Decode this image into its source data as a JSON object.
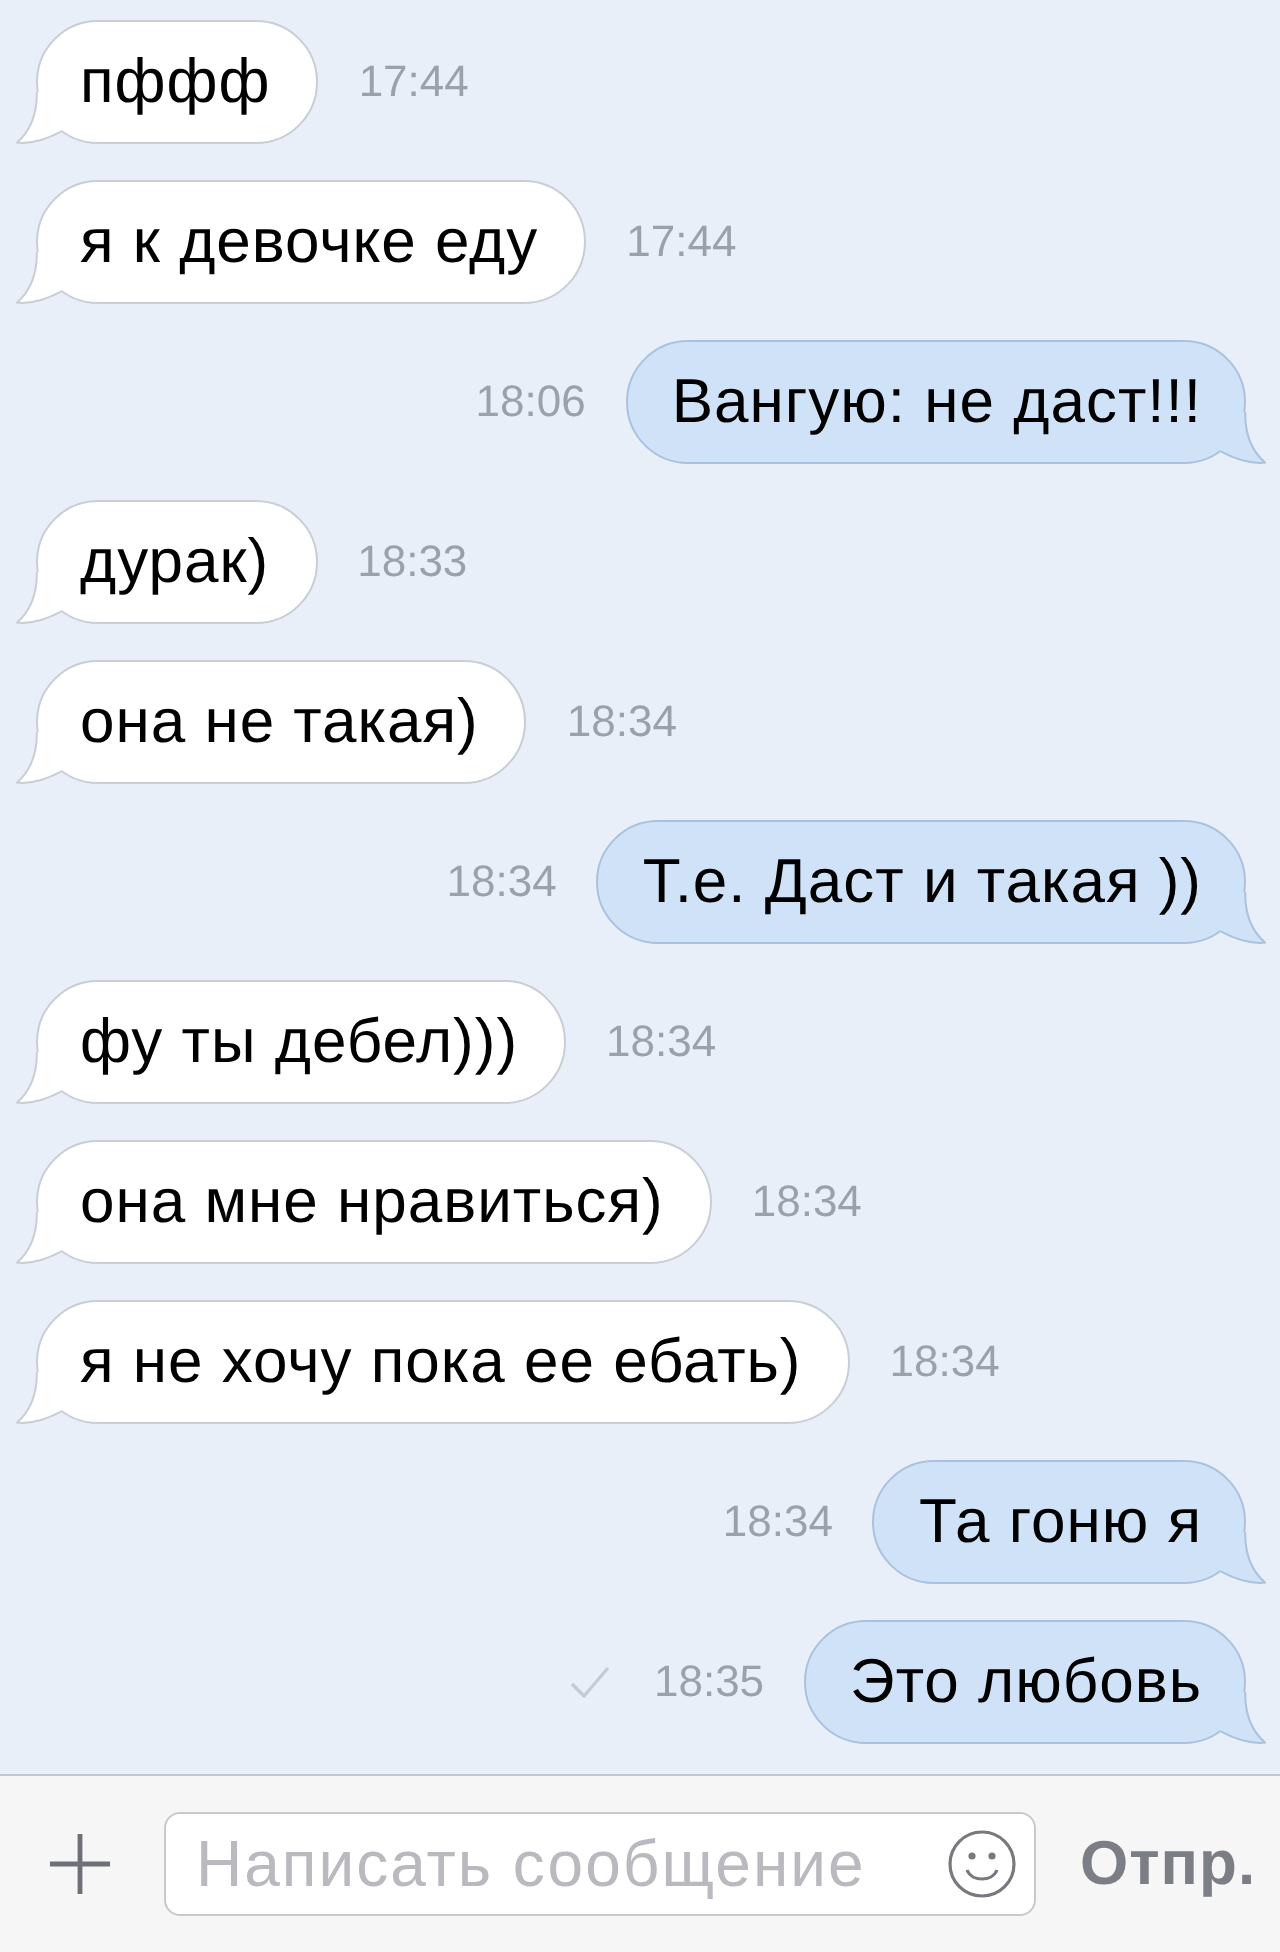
{
  "messages": [
    {
      "kind": "incoming",
      "text": "пффф",
      "time": "17:44",
      "ticked": false
    },
    {
      "kind": "incoming",
      "text": "я к девочке еду",
      "time": "17:44",
      "ticked": false
    },
    {
      "kind": "outgoing",
      "text": "Вангую: не даст!!!",
      "time": "18:06",
      "ticked": false
    },
    {
      "kind": "incoming",
      "text": "дурак)",
      "time": "18:33",
      "ticked": false
    },
    {
      "kind": "incoming",
      "text": "она не такая)",
      "time": "18:34",
      "ticked": false
    },
    {
      "kind": "outgoing",
      "text": "Т.е. Даст и такая ))",
      "time": "18:34",
      "ticked": false
    },
    {
      "kind": "incoming",
      "text": "фу ты дебел)))",
      "time": "18:34",
      "ticked": false
    },
    {
      "kind": "incoming",
      "text": "она мне нравиться)",
      "time": "18:34",
      "ticked": false
    },
    {
      "kind": "incoming",
      "text": "я не хочу пока ее ебать)",
      "time": "18:34",
      "ticked": false
    },
    {
      "kind": "outgoing",
      "text": "Та гоню я",
      "time": "18:34",
      "ticked": false
    },
    {
      "kind": "outgoing",
      "text": "Это любовь",
      "time": "18:35",
      "ticked": true
    }
  ],
  "composer": {
    "placeholder": "Написать сообщение",
    "send_label": "Отпр."
  }
}
